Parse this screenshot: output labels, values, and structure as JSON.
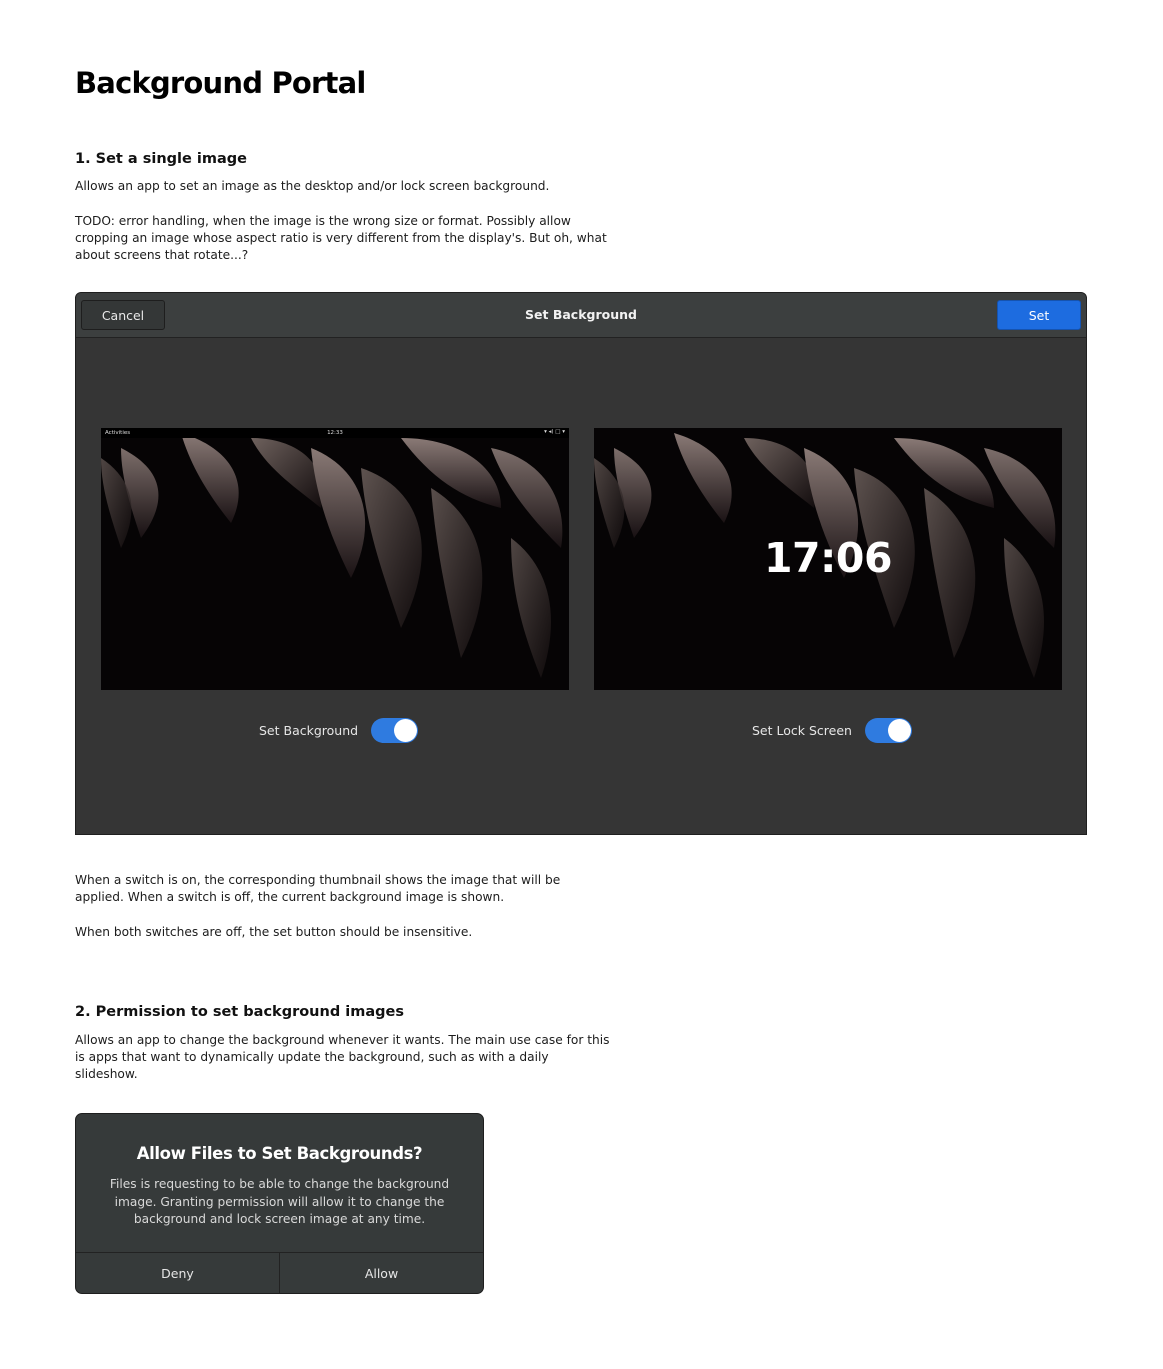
{
  "page": {
    "title": "Background Portal",
    "section1": {
      "heading": "1. Set a single image",
      "intro": "Allows an app to set an image as the desktop and/or lock screen background.",
      "todo_line1": "TODO: error handling, when the image is the wrong size or format. Possibly allow",
      "todo_line2": "cropping an image whose aspect ratio is very different from the display's. But oh, what",
      "todo_line3": "about screens that rotate...?",
      "note1_line1": "When a switch is on, the corresponding thumbnail shows the image that will be",
      "note1_line2": "applied. When a switch is off, the current background image is shown.",
      "note2": "When both switches are off, the set button should be insensitive."
    },
    "section2": {
      "heading": "2. Permission to set background images",
      "intro_line1": "Allows an app to change the background whenever it wants. The main use case for this",
      "intro_line2": "is apps that want to dynamically update the background, such as with a daily",
      "intro_line3": "slideshow."
    }
  },
  "set_dialog": {
    "title": "Set Background",
    "cancel_label": "Cancel",
    "set_label": "Set",
    "desktop_preview": {
      "activities_label": "Activities",
      "clock": "12:33",
      "status_icons": "▾ ◂) □ ▾"
    },
    "lock_preview": {
      "time": "17:06"
    },
    "switches": [
      {
        "label": "Set Background",
        "on": true
      },
      {
        "label": "Set Lock Screen",
        "on": true
      }
    ],
    "colors": {
      "accent": "#1d6ce0",
      "switch_on": "#2f7be0",
      "surface": "#353535",
      "headerbar": "#3c3f3f"
    }
  },
  "permission_dialog": {
    "title": "Allow Files to Set Backgrounds?",
    "body_line1": "Files is requesting to be able to change the background",
    "body_line2": "image. Granting permission will allow it to change the",
    "body_line3": "background and lock screen image at any time.",
    "deny_label": "Deny",
    "allow_label": "Allow"
  }
}
